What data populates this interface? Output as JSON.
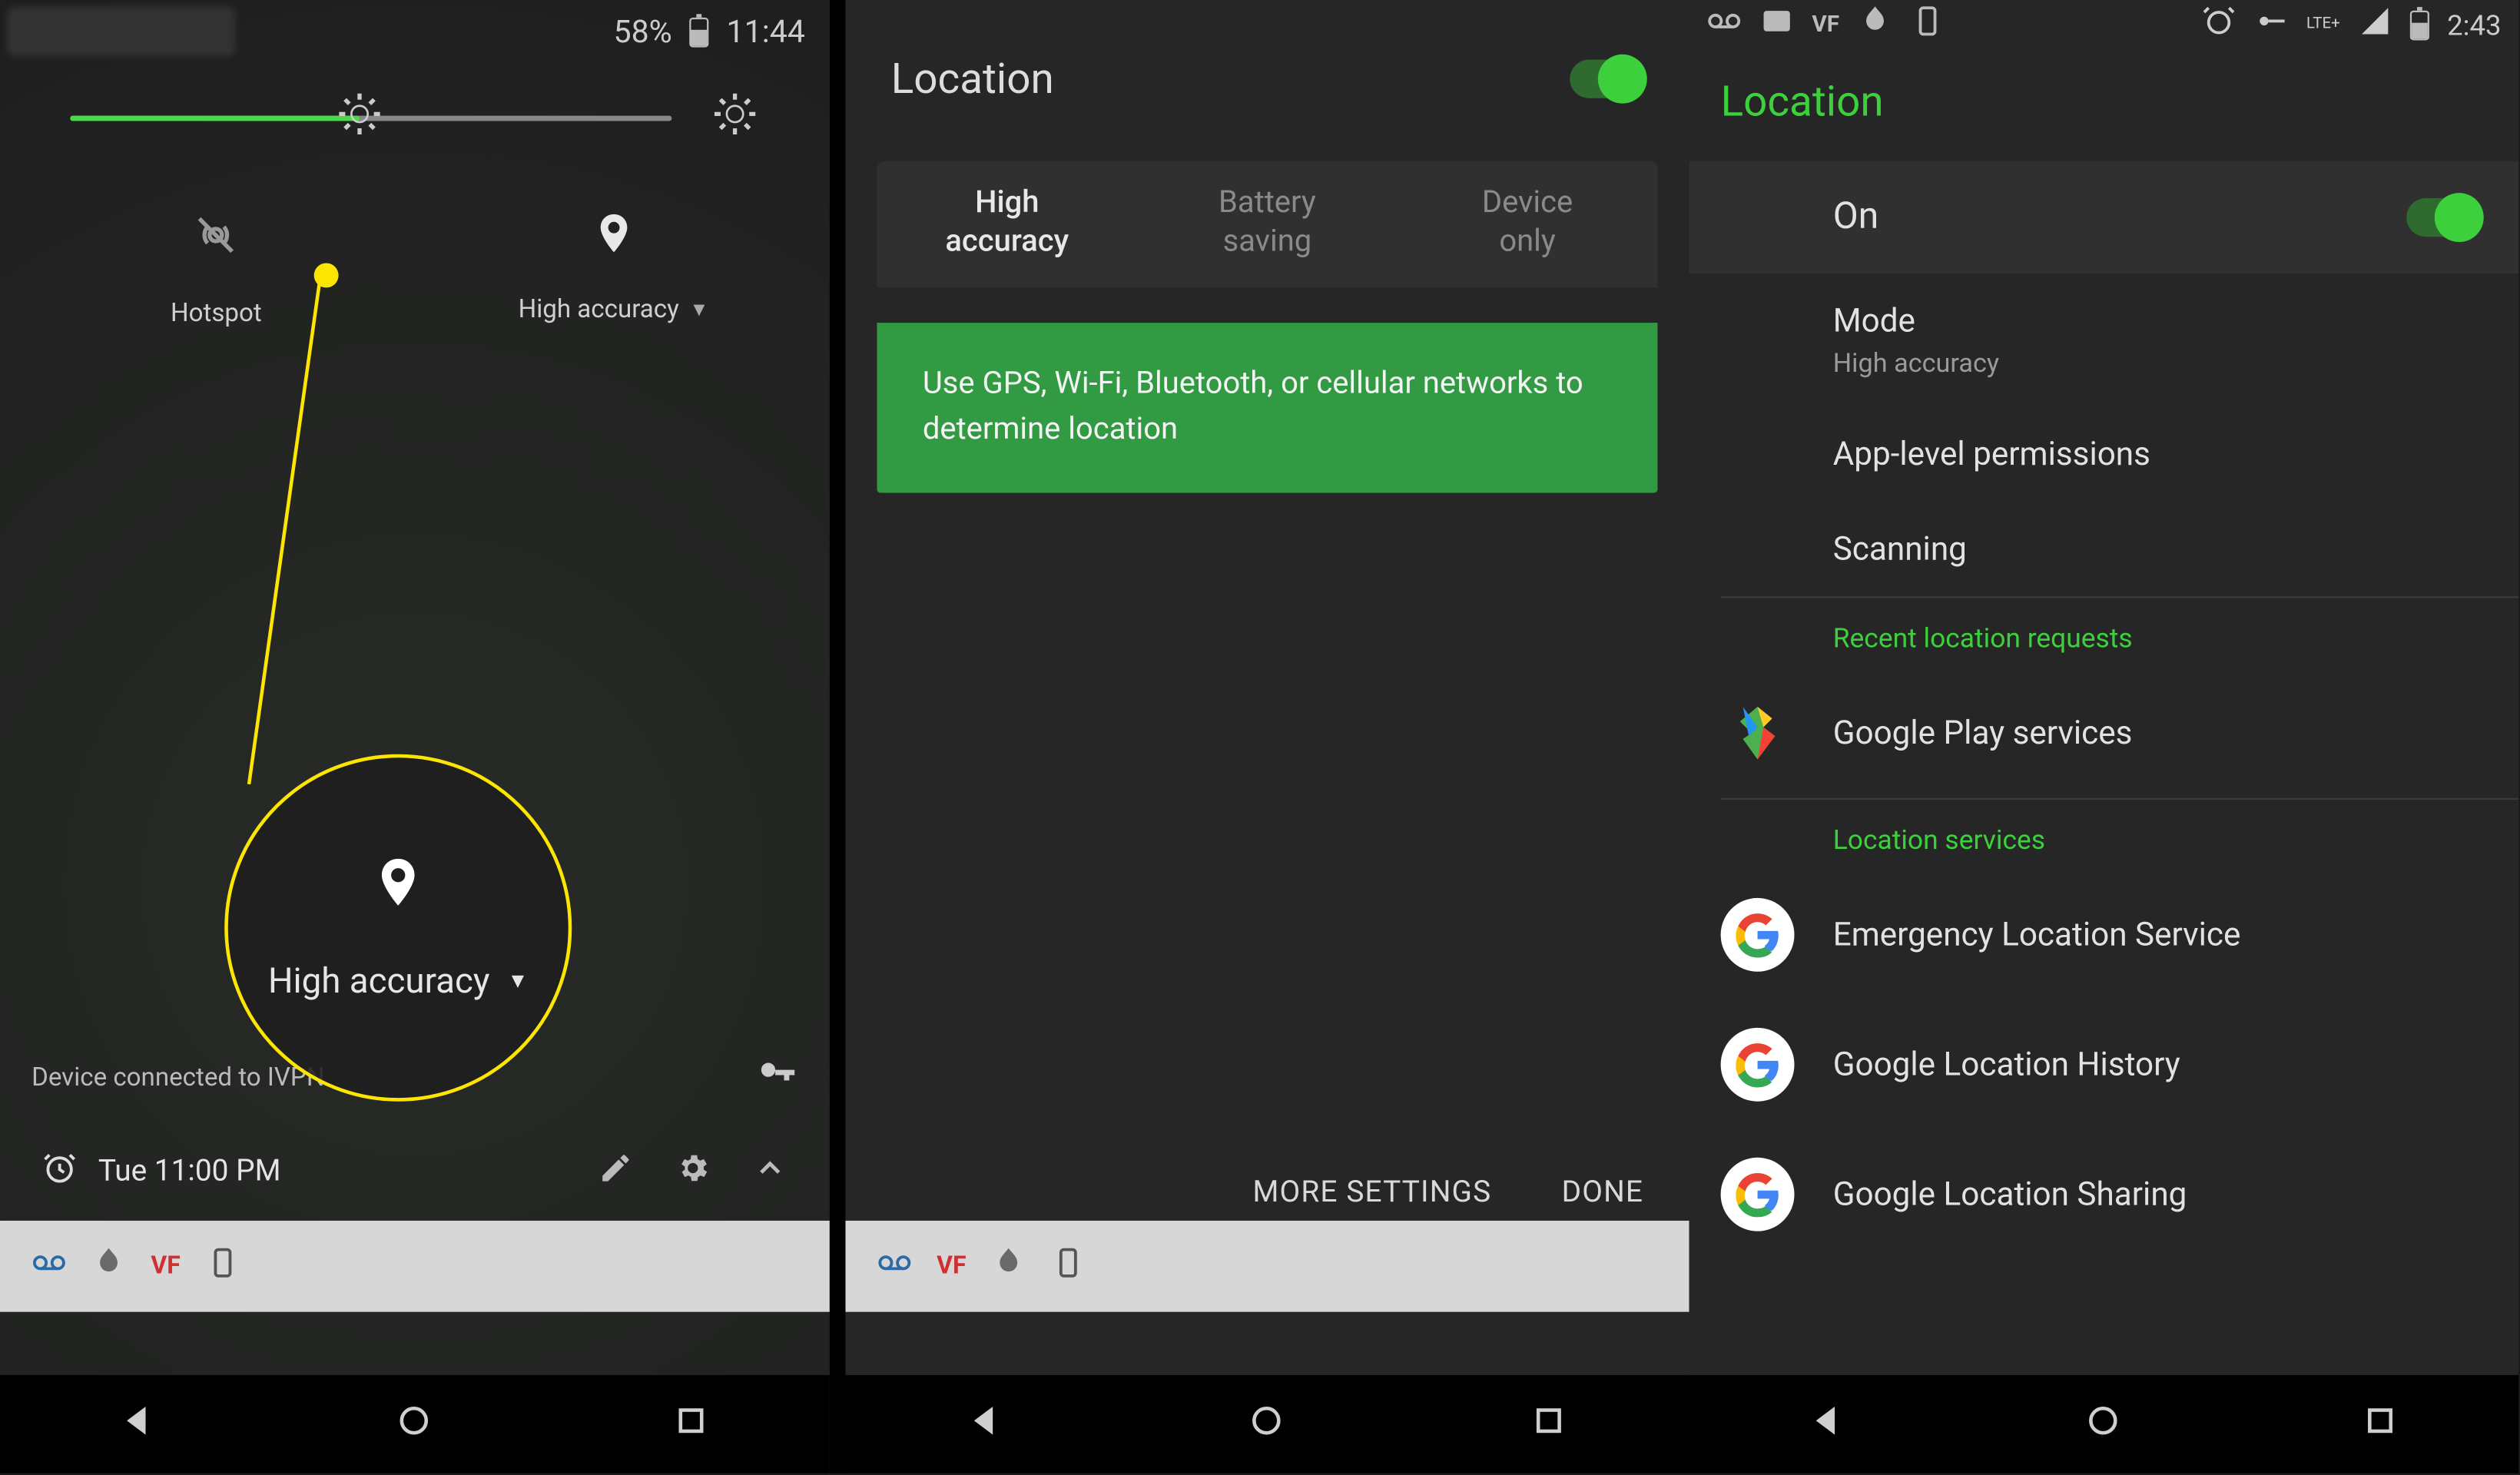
{
  "screen1": {
    "statusbar": {
      "battery_pct": "58%",
      "time": "11:44"
    },
    "tiles": {
      "hotspot": {
        "label": "Hotspot"
      },
      "location": {
        "label": "High accuracy"
      }
    },
    "annotation": {
      "label": "High accuracy"
    },
    "vpn_text": "Device connected to IVPN",
    "footer": {
      "alarm": "Tue 11:00 PM"
    }
  },
  "screen2": {
    "title": "Location",
    "toggle_on": true,
    "segments": {
      "high": "High\naccuracy",
      "battery": "Battery\nsaving",
      "device": "Device\nonly"
    },
    "desc": "Use GPS, Wi-Fi, Bluetooth, or cellular networks to determine location",
    "actions": {
      "more": "MORE SETTINGS",
      "done": "DONE"
    }
  },
  "screen3": {
    "statusbar": {
      "time": "2:43",
      "signal": "LTE+"
    },
    "title": "Location",
    "on_label": "On",
    "mode": {
      "title": "Mode",
      "value": "High accuracy"
    },
    "app_perm": "App-level permissions",
    "scanning": "Scanning",
    "recent_head": "Recent location requests",
    "recent_item": "Google Play services",
    "services_head": "Location services",
    "svc1": "Emergency Location Service",
    "svc2": "Google Location History",
    "svc3": "Google Location Sharing"
  }
}
